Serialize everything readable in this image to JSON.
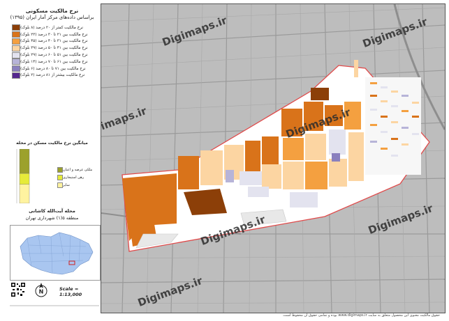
{
  "sidebar": {
    "title": "نرخ مالکیت مسکونی",
    "subtitle": "براساس داده‌های مرکز آمار ایران (۱۳۹۵)",
    "legend_items": [
      {
        "label": "نرخ مالکیت کمتر از ۲۰ درصد (۸ بلوک)",
        "color": "#8c3f08"
      },
      {
        "label": "نرخ مالکیت بین ۲۱ تا ۳۰ درصد (۲۳ بلوک)",
        "color": "#d9731a"
      },
      {
        "label": "نرخ مالکیت بین ۳۱ تا ۴۰ درصد (۴۵ بلوک)",
        "color": "#f4a040"
      },
      {
        "label": "نرخ مالکیت بین ۴۱ تا ۵۰ درصد (۳۹ بلوک)",
        "color": "#fcd5a2"
      },
      {
        "label": "نرخ مالکیت بین ۵۱ تا ۶۰ درصد (۲۹ بلوک)",
        "color": "#e3e3ef"
      },
      {
        "label": "نرخ مالکیت بین ۶۱ تا ۷۰ درصد (۱۴ بلوک)",
        "color": "#b7b4d8"
      },
      {
        "label": "نرخ مالکیت بین ۷۱ تا ۸۰ درصد (۶ بلوک)",
        "color": "#8a80be"
      },
      {
        "label": "نرخ مالکیت بیشتر از ۸۱ درصد (۲ بلوک)",
        "color": "#54278f"
      }
    ],
    "bar_chart_title": "میانگین نرخ مالکیت مسکن در محله",
    "bar_legend": [
      {
        "label": "ملکی عرصه و اعیان",
        "color": "#9ca12c"
      },
      {
        "label": "رهن استیجاری",
        "color": "#e6eb3a"
      },
      {
        "label": "سایر",
        "color": "#fff3a0"
      }
    ],
    "neighborhood": "محله آیت‌الله کاشانی",
    "district": "منطقه ۵(۱) شهرداری تهران",
    "scale": "Scale = 1:13,000"
  },
  "chart_data": {
    "type": "bar",
    "categories": [
      "محله"
    ],
    "series": [
      {
        "name": "ملکی عرصه و اعیان",
        "values": [
          45
        ]
      },
      {
        "name": "رهن استیجاری",
        "values": [
          20
        ]
      },
      {
        "name": "سایر",
        "values": [
          35
        ]
      }
    ],
    "ylim": [
      0,
      100
    ]
  },
  "map": {
    "watermark": "Digimaps.ir",
    "boundary_color": "#e04a4a",
    "background_color": "#bdbdbd"
  },
  "footer": {
    "text": "حقوق مالکیت معنوی این محصول متعلق به سایت www.digimaps.ir بوده و تمامی حقوق آن محفوظ است."
  },
  "colors": {
    "c1": "#8c3f08",
    "c2": "#d9731a",
    "c3": "#f4a040",
    "c4": "#fcd5a2",
    "c5": "#e3e3ef",
    "c6": "#b7b4d8",
    "c7": "#8a80be",
    "c8": "#54278f"
  }
}
